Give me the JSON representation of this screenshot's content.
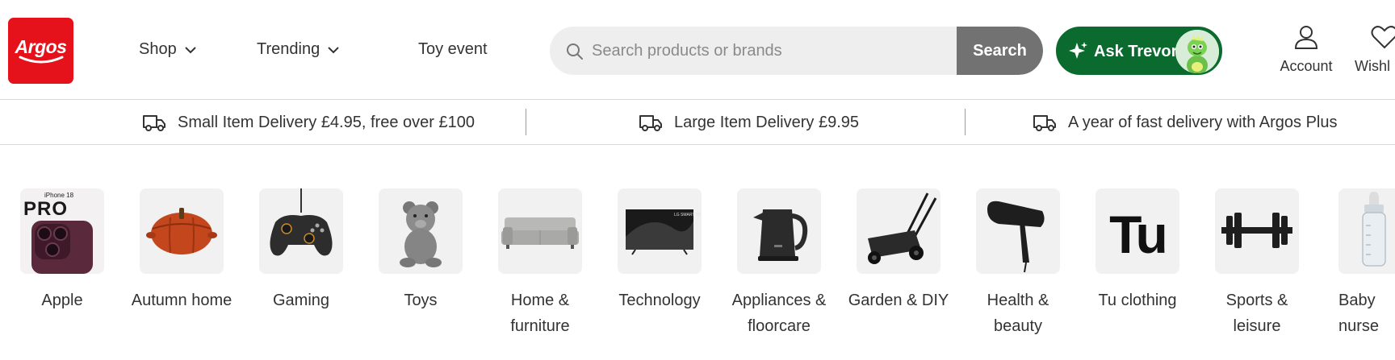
{
  "brand": {
    "logo_text": "Argos",
    "color": "#e5121b"
  },
  "nav": [
    {
      "label": "Shop",
      "has_dropdown": true
    },
    {
      "label": "Trending",
      "has_dropdown": true
    },
    {
      "label": "Toy event",
      "has_dropdown": false
    }
  ],
  "search": {
    "placeholder": "Search products or brands",
    "value": "",
    "button_label": "Search"
  },
  "assistant": {
    "label": "Ask Trevor",
    "color": "#0b6b2e"
  },
  "account": {
    "label": "Account"
  },
  "wishlist": {
    "label": "Wishl"
  },
  "delivery": [
    {
      "text": "Small Item Delivery £4.95, free over £100",
      "icon": "truck-icon"
    },
    {
      "text": "Large Item Delivery £9.95",
      "icon": "truck-icon"
    },
    {
      "text": "A year of fast delivery with Argos Plus",
      "icon": "truck-icon"
    }
  ],
  "categories": [
    {
      "label": "Apple",
      "icon": "iphone-17-pro-image",
      "tile_text": "iPhone 18",
      "tile_badge": "PRO"
    },
    {
      "label": "Autumn home",
      "icon": "pumpkin-casserole-pot-image"
    },
    {
      "label": "Gaming",
      "icon": "game-controller-image"
    },
    {
      "label": "Toys",
      "icon": "teddy-bear-image"
    },
    {
      "label": "Home & furniture",
      "icon": "sofa-image"
    },
    {
      "label": "Technology",
      "icon": "television-image",
      "tile_text": "LG SMART TV"
    },
    {
      "label": "Appliances & floorcare",
      "icon": "kettle-image"
    },
    {
      "label": "Garden & DIY",
      "icon": "lawn-mower-image"
    },
    {
      "label": "Health & beauty",
      "icon": "hair-dryer-image"
    },
    {
      "label": "Tu clothing",
      "icon": "tu-logo-image",
      "tile_text": "Tu"
    },
    {
      "label": "Sports & leisure",
      "icon": "dumbbell-image"
    },
    {
      "label": "Baby nurse",
      "icon": "baby-bottle-image"
    }
  ]
}
